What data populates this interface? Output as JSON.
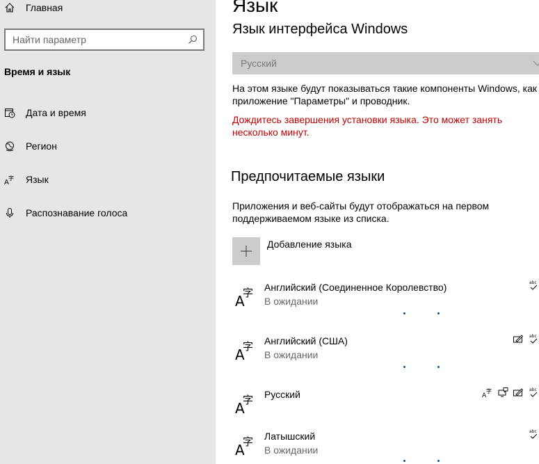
{
  "sidebar": {
    "home_label": "Главная",
    "search_placeholder": "Найти параметр",
    "section_title": "Время и язык",
    "items": [
      {
        "label": "Дата и время",
        "icon": "clock-calendar-icon"
      },
      {
        "label": "Регион",
        "icon": "globe-icon"
      },
      {
        "label": "Язык",
        "icon": "language-icon"
      },
      {
        "label": "Распознавание голоса",
        "icon": "microphone-icon"
      }
    ]
  },
  "main": {
    "title": "Язык",
    "interface_heading": "Язык интерфейса Windows",
    "interface_value": "Русский",
    "interface_info": "На этом языке будут показываться такие компоненты Windows, как приложение \"Параметры\" и проводник.",
    "warning": "Дождитесь завершения установки языка. Это может занять несколько минут.",
    "preferred_heading": "Предпочитаемые языки",
    "preferred_info": "Приложения и веб-сайты будут отображаться на первом поддерживаемом языке из списка.",
    "add_language_label": "Добавление языка",
    "languages": [
      {
        "name": "Английский (Соединенное Королевство)",
        "status": "В ожидании",
        "features": [
          "spellcheck-icon"
        ]
      },
      {
        "name": "Английский (США)",
        "status": "В ожидании",
        "features": [
          "handwriting-icon",
          "spellcheck-icon"
        ]
      },
      {
        "name": "Русский",
        "status": "",
        "features": [
          "display-language-icon",
          "speech-icon",
          "handwriting-icon",
          "spellcheck-icon"
        ]
      },
      {
        "name": "Латышский",
        "status": "В ожидании",
        "features": [
          "spellcheck-icon"
        ]
      }
    ]
  },
  "colors": {
    "sidebar_bg": "#e6e6e6",
    "warning": "#c00000",
    "progress_dots": "#0050a0",
    "dropdown_bg": "#cccccc"
  }
}
